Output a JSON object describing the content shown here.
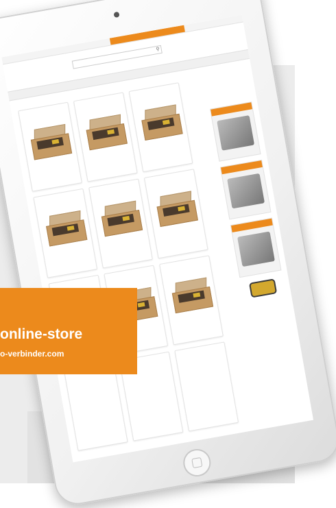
{
  "overlay": {
    "title": "online-store",
    "url": "o-verbinder.com"
  },
  "colors": {
    "accent": "#ec8a1c",
    "background": "#ececec"
  },
  "icons": [
    "camera-icon",
    "home-button-icon",
    "search-icon",
    "box-icon",
    "award-icon"
  ]
}
